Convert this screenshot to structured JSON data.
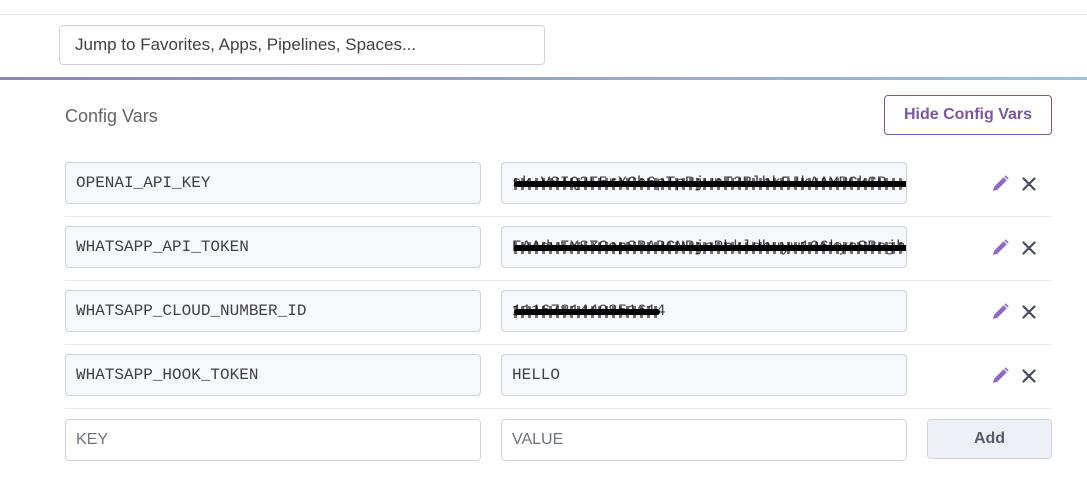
{
  "header": {
    "search_placeholder": "Jump to Favorites, Apps, Pipelines, Spaces..."
  },
  "config_vars": {
    "title": "Config Vars",
    "hide_label": "Hide Config Vars",
    "items": [
      {
        "key": "OPENAI_API_KEY",
        "value": "sk-VSIQ3F5rXCh6pTpRjwnT3BlbkFJkAAYRCkGR",
        "redacted": true
      },
      {
        "key": "WHATSAPP_API_TOKEN",
        "value": "EAAdwEXSZCopSBABCNPjoPhkldbuyw106kyeSBejh",
        "redacted": true
      },
      {
        "key": "WHATSAPP_CLOUD_NUMBER_ID",
        "value": "1116781440851614",
        "redacted": true
      },
      {
        "key": "WHATSAPP_HOOK_TOKEN",
        "value": "HELLO",
        "redacted": false
      }
    ],
    "new_key_placeholder": "KEY",
    "new_value_placeholder": "VALUE",
    "add_label": "Add"
  },
  "icons": {
    "edit": "pencil-icon",
    "delete": "close-icon"
  },
  "colors": {
    "brand_purple": "#79589f",
    "edit_icon": "#8e6cbf",
    "delete_icon": "#474a55"
  }
}
